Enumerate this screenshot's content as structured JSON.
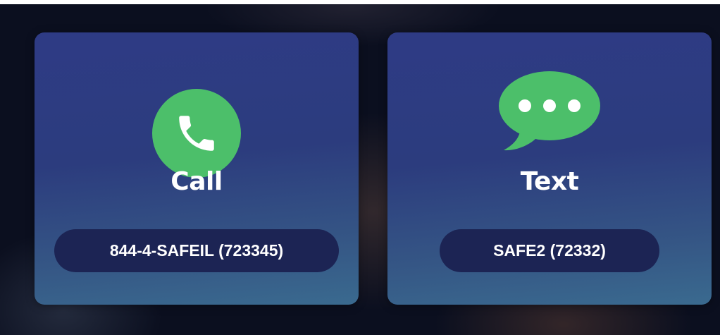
{
  "colors": {
    "icon_green": "#4cbf6a",
    "card_top": "#2e3b85",
    "card_bottom": "#3a6a8f",
    "pill_bg": "#1c2454",
    "text": "#ffffff"
  },
  "cards": [
    {
      "id": "call",
      "icon": "phone-icon",
      "title": "Call",
      "number": "844-4-SAFEIL (723345)"
    },
    {
      "id": "text",
      "icon": "chat-bubble-icon",
      "title": "Text",
      "number": "SAFE2 (72332)"
    }
  ]
}
